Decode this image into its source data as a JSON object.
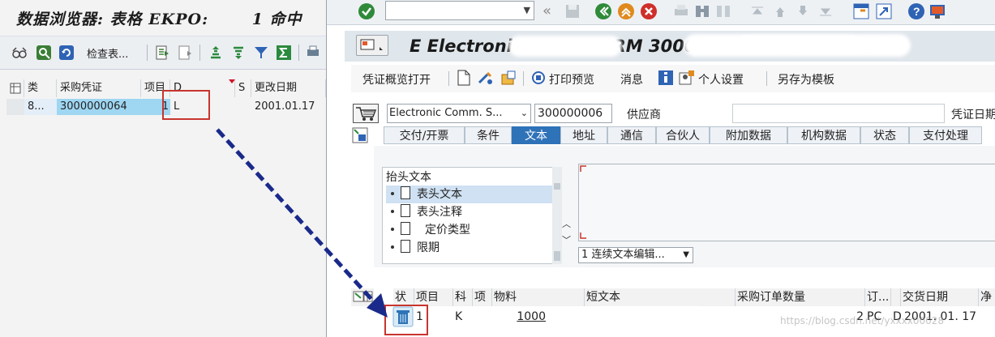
{
  "left_window": {
    "title": "数据浏览器: 表格 EKPO:",
    "title_suffix": "1 命中",
    "toolbar": {
      "check_table": "检查表..."
    },
    "grid": {
      "columns": [
        "类",
        "采购凭证",
        "项目",
        "D",
        "S",
        "更改日期"
      ],
      "row": {
        "category": "8...",
        "purchase_doc": "3000000064",
        "item": "1",
        "deletion_indicator": "L",
        "status": "",
        "change_date": "2001.01.17"
      }
    }
  },
  "right_window": {
    "title": "E  Electronic Comm. SRM 3000000064 已被 ...... 创建",
    "toolbar": {
      "doc_overview": "凭证概览打开",
      "print_preview": "打印预览",
      "messages": "消息",
      "personal_settings": "个人设置",
      "save_as_template": "另存为模板"
    },
    "header": {
      "doc_type": "Electronic Comm. S...",
      "doc_number": "300000006",
      "vendor_label": "供应商",
      "voucher_date_label": "凭证日期"
    },
    "tabs": [
      "交付/开票",
      "条件",
      "文本",
      "地址",
      "通信",
      "合伙人",
      "附加数据",
      "机构数据",
      "状态",
      "支付处理"
    ],
    "active_tab": "文本",
    "texts": {
      "title": "抬头文本",
      "items": [
        "表头文本",
        "表头注释",
        "定价类型",
        "限期"
      ],
      "editor_mode": "1 连续文本编辑..."
    },
    "items_grid": {
      "columns": [
        "状",
        "项目",
        "科",
        "项",
        "物料",
        "短文本",
        "采购订单数量",
        "订...",
        "交货日期",
        "净"
      ],
      "row": {
        "item": "1",
        "account": "K",
        "material": "1000",
        "quantity": "2",
        "unit": "PC",
        "date_cat": "D",
        "delivery_date": "2001. 01. 17"
      }
    }
  },
  "watermark": "https://blog.csdn.net/yxxxx00028",
  "colors": {
    "active_tab": "#2e72b8",
    "highlight": "#9fd6f2",
    "annotation_red": "#c8352e",
    "arrow": "#1a2a8a"
  }
}
